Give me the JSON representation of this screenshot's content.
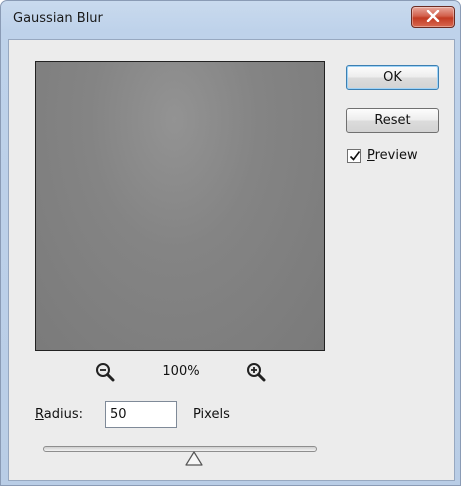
{
  "window": {
    "title": "Gaussian Blur"
  },
  "buttons": {
    "ok_label": "OK",
    "reset_label": "Reset"
  },
  "preview_toggle": {
    "label_mnemonic": "P",
    "label_rest": "review",
    "checked": true
  },
  "zoom": {
    "level": "100%"
  },
  "radius": {
    "label_mnemonic": "R",
    "label_rest": "adius:",
    "value": "50",
    "unit": "Pixels",
    "slider_fraction": 0.55
  },
  "icons": {
    "close": "close-icon",
    "zoom_out": "zoom-out-icon",
    "zoom_in": "zoom-in-icon",
    "check": "checkmark-icon",
    "slider_thumb": "triangle-thumb-icon"
  },
  "colors": {
    "titlebar": "#bed2ea",
    "close_button": "#c23a22",
    "dialog_background": "#ececec",
    "preview_gray": "#848484"
  }
}
